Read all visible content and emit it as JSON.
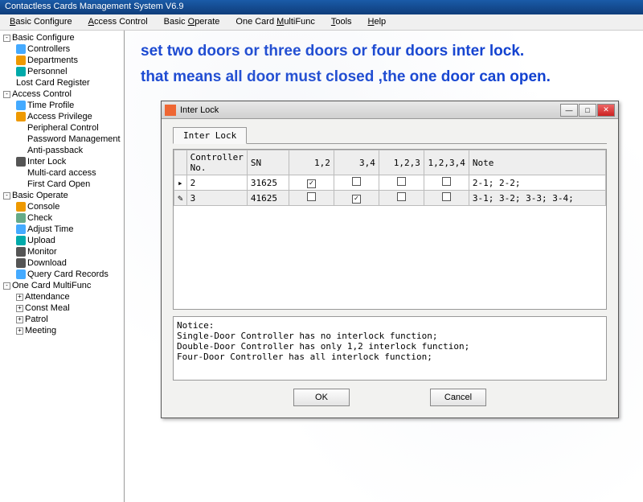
{
  "window": {
    "title": "Contactless Cards Management System  V6.9"
  },
  "menu": {
    "basic_configure": "Basic Configure",
    "access_control": "Access Control",
    "basic_operate": "Basic Operate",
    "one_card": "One Card MultiFunc",
    "tools": "Tools",
    "help": "Help"
  },
  "tree": {
    "basic_configure": "Basic Configure",
    "controllers": "Controllers",
    "departments": "Departments",
    "personnel": "Personnel",
    "lost_card_register": "Lost Card Register",
    "access_control": "Access Control",
    "time_profile": "Time Profile",
    "access_privilege": "Access Privilege",
    "peripheral_control": "Peripheral Control",
    "password_management": "Password Management",
    "anti_passback": "Anti-passback",
    "inter_lock": "Inter Lock",
    "multi_card_access": "Multi-card access",
    "first_card_open": "First Card Open",
    "basic_operate": "Basic Operate",
    "console": "Console",
    "check": "Check",
    "adjust_time": "Adjust Time",
    "upload": "Upload",
    "monitor": "Monitor",
    "download": "Download",
    "query_card_records": "Query Card Records",
    "one_card_multifunc": "One Card MultiFunc",
    "attendance": "Attendance",
    "const_meal": "Const Meal",
    "patrol": "Patrol",
    "meeting": "Meeting"
  },
  "annotation": {
    "line1": "set two doors or three doors or four doors inter lock.",
    "line2": "that means all door must closed ,the one door can open."
  },
  "dialog": {
    "title": "Inter Lock",
    "tab_label": "Inter Lock",
    "columns": {
      "controller_no": "Controller No.",
      "sn": "SN",
      "c12": "1,2",
      "c34": "3,4",
      "c123": "1,2,3",
      "c1234": "1,2,3,4",
      "note": "Note"
    },
    "rows": [
      {
        "no": "2",
        "sn": "31625",
        "c12": true,
        "c34": false,
        "c123": false,
        "c1234": false,
        "note": "2-1;  2-2;"
      },
      {
        "no": "3",
        "sn": "41625",
        "c12": false,
        "c34": true,
        "c123": false,
        "c1234": false,
        "note": "3-1;  3-2;  3-3;  3-4;"
      }
    ],
    "notice": "Notice:\nSingle-Door Controller has no interlock function;\nDouble-Door Controller has only 1,2 interlock function;\nFour-Door Controller has all interlock function;",
    "ok": "OK",
    "cancel": "Cancel"
  }
}
